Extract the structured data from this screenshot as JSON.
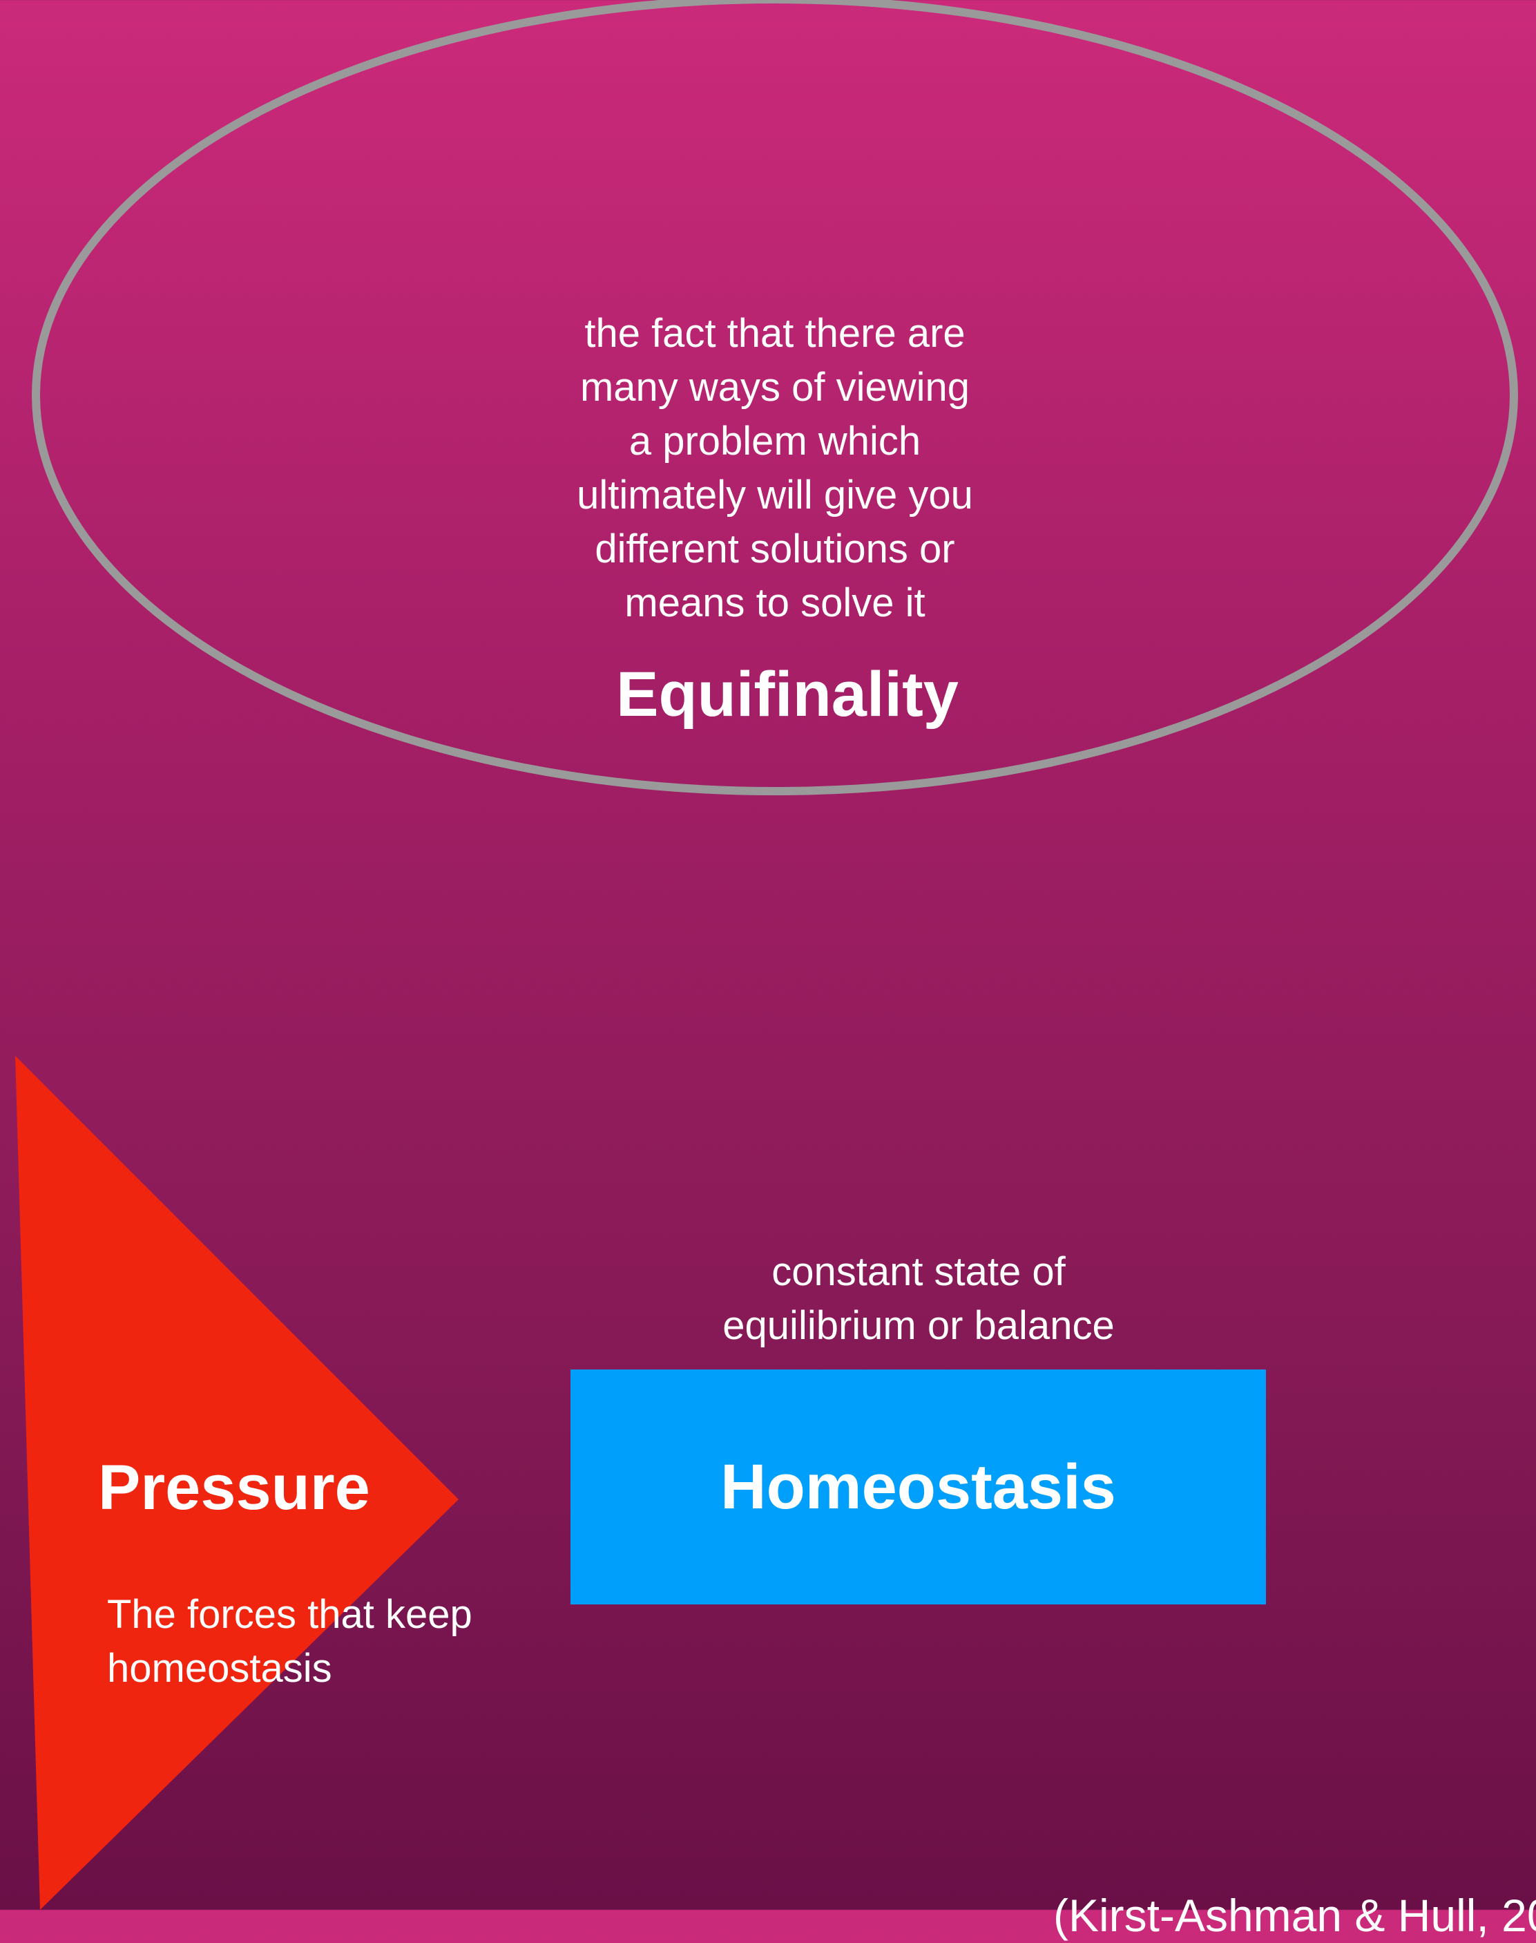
{
  "equifinality": {
    "title": "Equifinality",
    "description_lines": [
      "the fact that there are",
      "many ways of viewing",
      "a problem which",
      "ultimately will give you",
      "different solutions or",
      "means to solve it"
    ]
  },
  "homeostasis": {
    "title": "Homeostasis",
    "description_lines": [
      "constant state of",
      "equilibrium or balance"
    ]
  },
  "pressure": {
    "title": "Pressure",
    "description_lines": [
      "The forces that keep",
      "homeostasis"
    ]
  },
  "citation": "(Kirst-Ashman & Hull, 20",
  "colors": {
    "background_top": "#cb2a7a",
    "background_bottom": "#6a1047",
    "ellipse_stroke": "#9a9a9a",
    "pressure_triangle": "#ef2510",
    "homeostasis_box": "#009ffc",
    "text": "#ffffff"
  }
}
